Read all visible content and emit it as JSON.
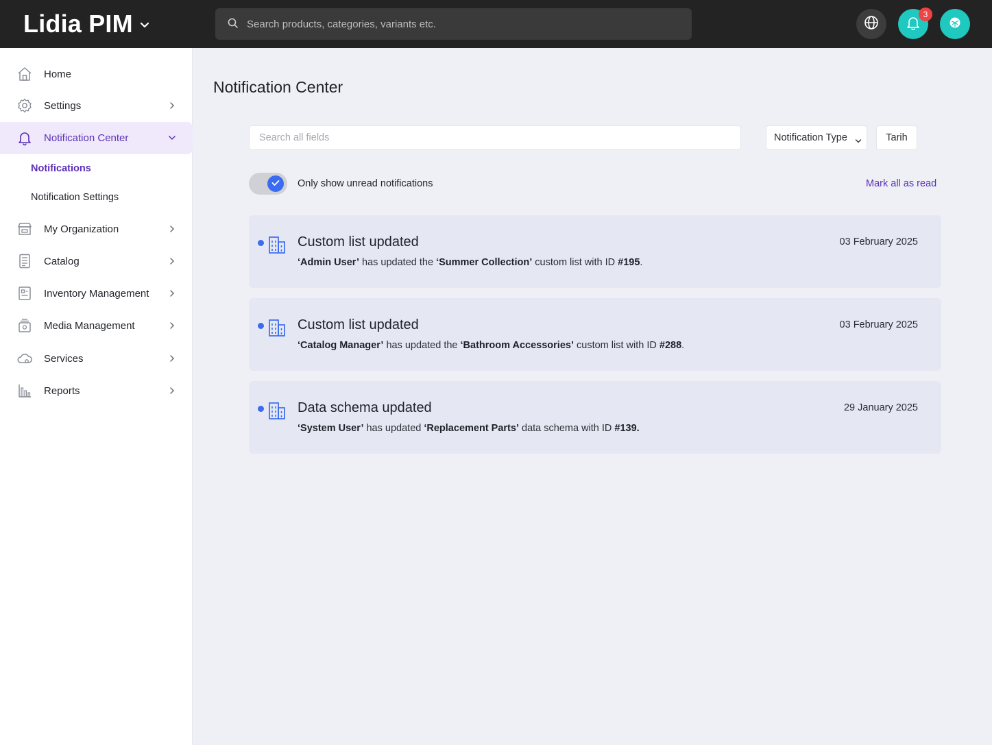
{
  "header": {
    "brand": "Lidia PIM",
    "search_placeholder": "Search products, categories, variants etc.",
    "notification_count": "3"
  },
  "sidebar": {
    "items": [
      {
        "label": "Home",
        "icon": "home-icon"
      },
      {
        "label": "Settings",
        "icon": "gear-icon"
      },
      {
        "label": "Notification Center",
        "icon": "bell-icon"
      },
      {
        "label": "My Organization",
        "icon": "store-icon"
      },
      {
        "label": "Catalog",
        "icon": "catalog-icon"
      },
      {
        "label": "Inventory Management",
        "icon": "inventory-icon"
      },
      {
        "label": "Media Management",
        "icon": "media-icon"
      },
      {
        "label": "Services",
        "icon": "cloud-icon"
      },
      {
        "label": "Reports",
        "icon": "chart-icon"
      }
    ],
    "sub_items": [
      {
        "label": "Notifications"
      },
      {
        "label": "Notification Settings"
      }
    ]
  },
  "main": {
    "title": "Notification Center",
    "search_placeholder": "Search all fields",
    "type_filter_label": "Notification Type",
    "date_filter_label": "Tarih",
    "toggle_label": "Only show unread notifications",
    "mark_all_label": "Mark all as read",
    "notifications": [
      {
        "title": "Custom list updated",
        "date": "03 February 2025",
        "q1": "‘",
        "actor": "Admin User",
        "q2": "’",
        "text1": " has updated the ",
        "q3": "‘",
        "target": "Summer Collection",
        "q4": "’",
        "text2": " custom list with ID ",
        "id": "#195",
        "end": "."
      },
      {
        "title": "Custom list updated",
        "date": "03 February 2025",
        "q1": "‘",
        "actor": "Catalog Manager",
        "q2": "’",
        "text1": " has updated the ",
        "q3": "‘",
        "target": "Bathroom Accessories",
        "q4": "’",
        "text2": " custom list with ID ",
        "id": "#288",
        "end": "."
      },
      {
        "title": "Data schema updated",
        "date": "29 January 2025",
        "q1": "‘",
        "actor": "System User",
        "q2": "’",
        "text1": " has updated ",
        "q3": "‘",
        "target": "Replacement Parts",
        "q4": "’",
        "text2": " data schema with ID ",
        "id": "#139.",
        "end": ""
      }
    ]
  },
  "colors": {
    "accent": "#5b2fb5",
    "teal": "#1fc9c0",
    "unread_dot": "#3b6cf0",
    "badge": "#ef4444"
  }
}
